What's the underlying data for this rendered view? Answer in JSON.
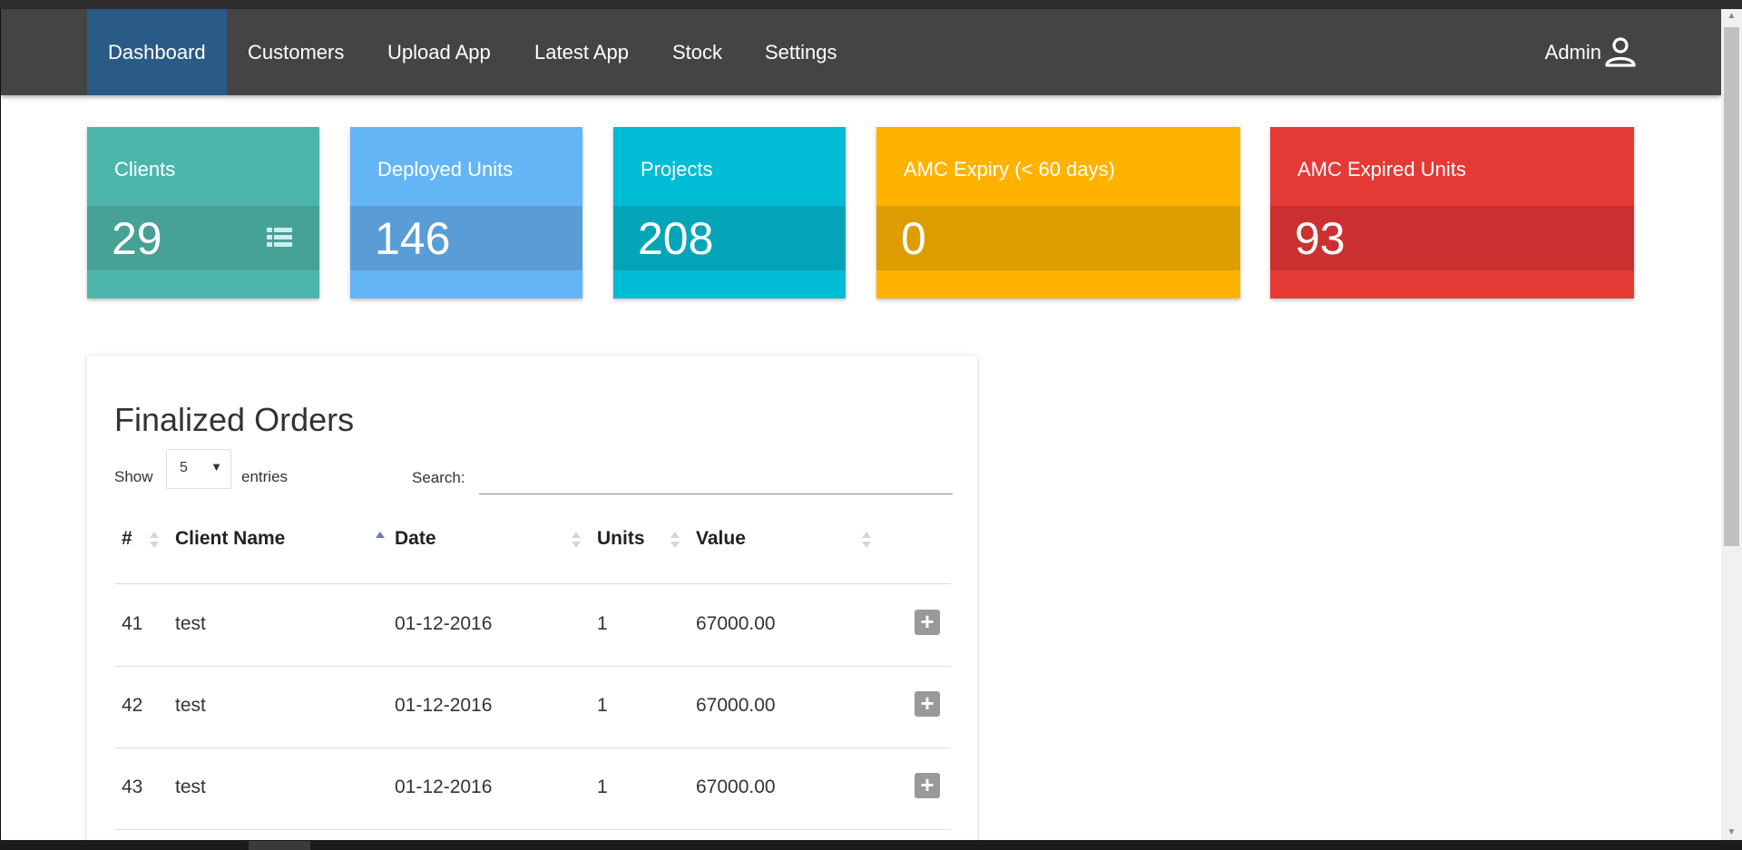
{
  "nav": {
    "items": [
      {
        "label": "Dashboard",
        "active": true
      },
      {
        "label": "Customers"
      },
      {
        "label": "Upload App"
      },
      {
        "label": "Latest App"
      },
      {
        "label": "Stock"
      },
      {
        "label": "Settings"
      }
    ],
    "user_label": "Admin",
    "user_icon": "user-icon"
  },
  "cards": [
    {
      "title": "Clients",
      "value": "29",
      "color": "#4db6ac",
      "band_color": "#46a197",
      "icon": "list-icon"
    },
    {
      "title": "Deployed Units",
      "value": "146",
      "color": "#64b5f6",
      "band_color": "#5a9dd6"
    },
    {
      "title": "Projects",
      "value": "208",
      "color": "#00bcd4",
      "band_color": "#05a5b9"
    },
    {
      "title": "AMC Expiry (< 60 days)",
      "value": "0",
      "color": "#ffb300",
      "band_color": "#dd9c00"
    },
    {
      "title": "AMC Expired Units",
      "value": "93",
      "color": "#e53935",
      "band_color": "#ca3130"
    }
  ],
  "orders": {
    "title": "Finalized Orders",
    "show_label": "Show",
    "page_length": "5",
    "entries_label": "entries",
    "search_label": "Search:",
    "search_value": "",
    "columns": [
      "#",
      "Client Name",
      "Date",
      "Units",
      "Value"
    ],
    "sorted_column": "Client Name",
    "sort_direction": "ascending",
    "rows": [
      {
        "id": "41",
        "client": "test",
        "date": "01-12-2016",
        "units": "1",
        "value": "67000.00"
      },
      {
        "id": "42",
        "client": "test",
        "date": "01-12-2016",
        "units": "1",
        "value": "67000.00"
      },
      {
        "id": "43",
        "client": "test",
        "date": "01-12-2016",
        "units": "1",
        "value": "67000.00"
      }
    ]
  }
}
